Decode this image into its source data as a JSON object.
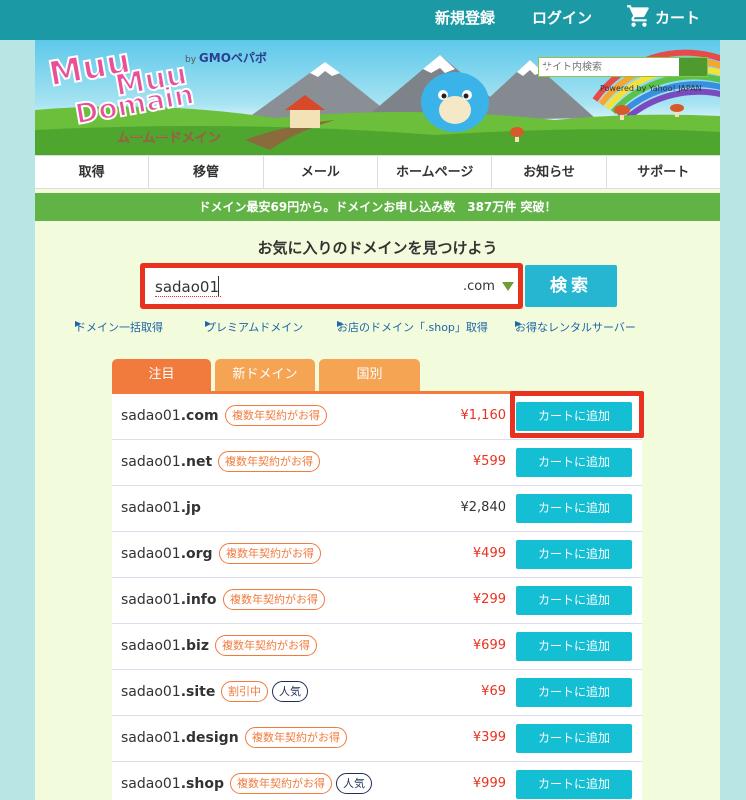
{
  "topbar": {
    "signup": "新規登録",
    "login": "ログイン",
    "cart": "カート"
  },
  "banner": {
    "logo_text": "MuuMuu Domain",
    "logo_sub": "ムームードメイン",
    "by": "by",
    "gmo": "GMOペパボ",
    "site_search_placeholder": "サイト内検索",
    "powered": "Powered by Yahoo! JAPAN"
  },
  "nav": [
    "取得",
    "移管",
    "メール",
    "ホームページ",
    "お知らせ",
    "サポート"
  ],
  "promo": "ドメイン最安69円から。ドメインお申し込み数　387万件 突破！",
  "search": {
    "heading": "お気に入りのドメインを見つけよう",
    "value": "sadao01",
    "tld": ".com",
    "button": "検索"
  },
  "sublinks": [
    "ドメイン一括取得",
    "プレミアムドメイン",
    "お店のドメイン「.shop」取得",
    "お得なレンタルサーバー"
  ],
  "tabs": [
    "注目",
    "新ドメイン",
    "国別"
  ],
  "results": [
    {
      "name": "sadao01",
      "tld": ".com",
      "badges": [
        "複数年契約がお得"
      ],
      "price": "¥1,160",
      "sale": true,
      "button": "カートに追加"
    },
    {
      "name": "sadao01",
      "tld": ".net",
      "badges": [
        "複数年契約がお得"
      ],
      "price": "¥599",
      "sale": true,
      "button": "カートに追加"
    },
    {
      "name": "sadao01",
      "tld": ".jp",
      "badges": [],
      "price": "¥2,840",
      "sale": false,
      "button": "カートに追加"
    },
    {
      "name": "sadao01",
      "tld": ".org",
      "badges": [
        "複数年契約がお得"
      ],
      "price": "¥499",
      "sale": true,
      "button": "カートに追加"
    },
    {
      "name": "sadao01",
      "tld": ".info",
      "badges": [
        "複数年契約がお得"
      ],
      "price": "¥299",
      "sale": true,
      "button": "カートに追加"
    },
    {
      "name": "sadao01",
      "tld": ".biz",
      "badges": [
        "複数年契約がお得"
      ],
      "price": "¥699",
      "sale": true,
      "button": "カートに追加"
    },
    {
      "name": "sadao01",
      "tld": ".site",
      "badges": [
        "割引中",
        "人気"
      ],
      "price": "¥69",
      "sale": true,
      "button": "カートに追加"
    },
    {
      "name": "sadao01",
      "tld": ".design",
      "badges": [
        "複数年契約がお得"
      ],
      "price": "¥399",
      "sale": true,
      "button": "カートに追加"
    },
    {
      "name": "sadao01",
      "tld": ".shop",
      "badges": [
        "複数年契約がお得",
        "人気"
      ],
      "price": "¥999",
      "sale": true,
      "button": "カートに追加"
    }
  ]
}
